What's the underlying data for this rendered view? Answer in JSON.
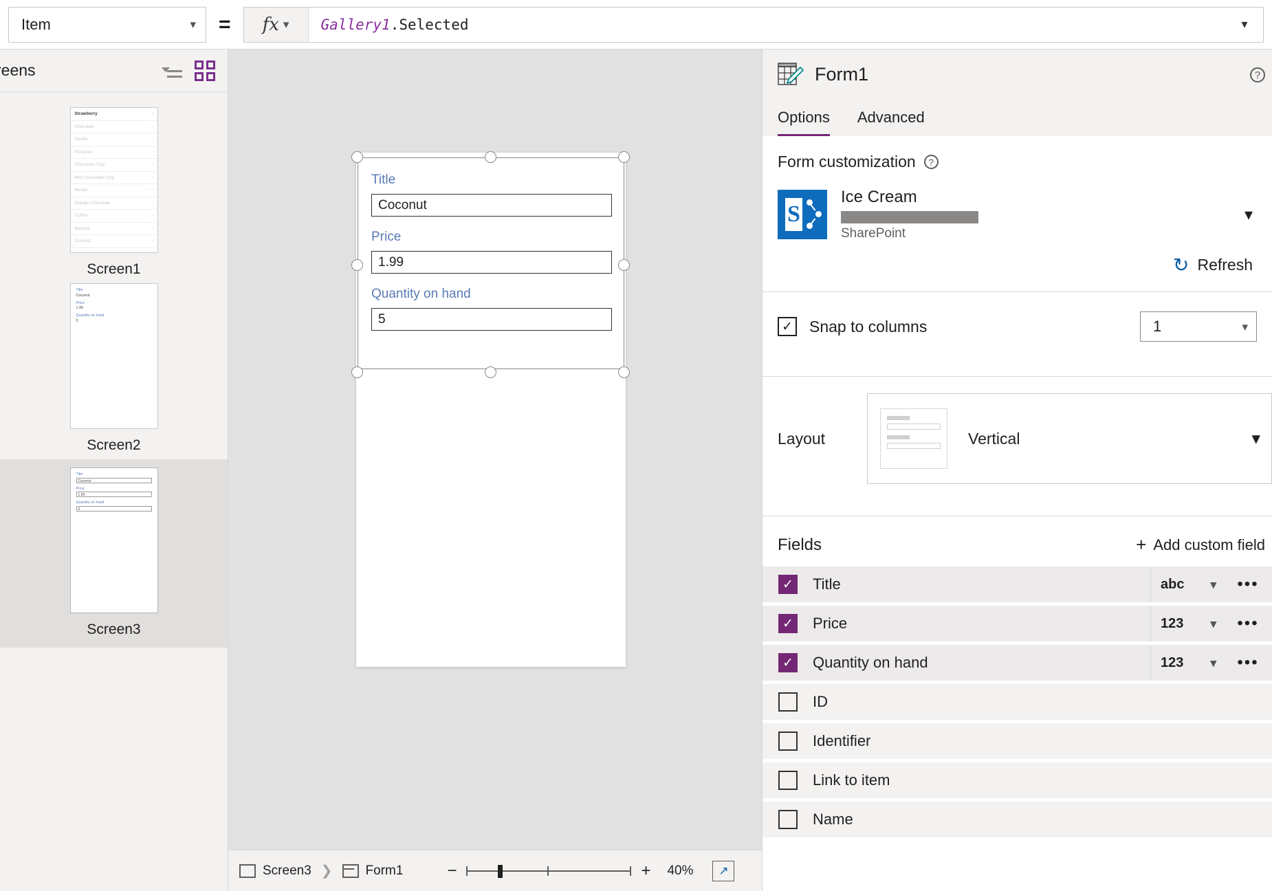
{
  "formula_bar": {
    "property": "Item",
    "equals": "=",
    "fx_label": "fx",
    "formula_identifier": "Gallery1",
    "formula_rest": ".Selected",
    "expand_icon": "chevron-down"
  },
  "left_pane": {
    "title": "reens",
    "tree_view_icon": "tree-view-icon",
    "grid_view_icon": "grid-view-icon",
    "screens": [
      {
        "label": "Screen1",
        "type": "gallery",
        "items": [
          "Strawberry",
          "Chocolate",
          "Vanilla",
          "Pistachio",
          "Chocolate Chip",
          "Mint Chocolate Chip",
          "Mango",
          "Orange Chocolate",
          "Coffee",
          "Banana",
          "Coconut"
        ]
      },
      {
        "label": "Screen2",
        "type": "form-text",
        "fields": [
          {
            "label": "Title",
            "value": "Coconut"
          },
          {
            "label": "Price",
            "value": "1.99"
          },
          {
            "label": "Quantity on hand",
            "value": "5"
          }
        ]
      },
      {
        "label": "Screen3",
        "type": "form-boxes",
        "selected": true,
        "fields": [
          {
            "label": "Title",
            "value": "Coconut"
          },
          {
            "label": "Price",
            "value": "1.99"
          },
          {
            "label": "Quantity on hand",
            "value": "5"
          }
        ]
      }
    ]
  },
  "canvas": {
    "form": {
      "fields": [
        {
          "label": "Title",
          "value": "Coconut"
        },
        {
          "label": "Price",
          "value": "1.99"
        },
        {
          "label": "Quantity on hand",
          "value": "5"
        }
      ]
    }
  },
  "status_bar": {
    "breadcrumb": [
      {
        "label": "Screen3",
        "icon": "screen-icon"
      },
      {
        "label": "Form1",
        "icon": "form-icon"
      }
    ],
    "zoom_out": "−",
    "zoom_in": "+",
    "zoom_level": "40%",
    "fit_icon": "fit-to-screen-icon"
  },
  "right_pane": {
    "title": "Form1",
    "icon": "form-edit-icon",
    "help_icon": "?",
    "tabs": [
      {
        "label": "Options",
        "active": true
      },
      {
        "label": "Advanced",
        "active": false
      }
    ],
    "form_customization": {
      "title": "Form customization",
      "help": "?",
      "data_source": {
        "name": "Ice Cream",
        "account_redacted": "",
        "kind": "SharePoint",
        "icon": "sharepoint-icon",
        "chevron": "chevron-down"
      },
      "refresh": {
        "label": "Refresh",
        "icon": "refresh-icon"
      }
    },
    "snap_to_columns": {
      "label": "Snap to columns",
      "checked": true,
      "check_glyph": "✓",
      "columns_value": "1",
      "chevron": "chevron-down"
    },
    "layout": {
      "label": "Layout",
      "value": "Vertical",
      "chevron": "chevron-down"
    },
    "fields_section": {
      "title": "Fields",
      "add_label": "Add custom field",
      "add_icon": "plus-icon",
      "rows": [
        {
          "name": "Title",
          "checked": true,
          "type": "abc",
          "more": "•••"
        },
        {
          "name": "Price",
          "checked": true,
          "type": "123",
          "more": "•••"
        },
        {
          "name": "Quantity on hand",
          "checked": true,
          "type": "123",
          "more": "•••"
        },
        {
          "name": "ID",
          "checked": false,
          "type": "",
          "more": ""
        },
        {
          "name": "Identifier",
          "checked": false,
          "type": "",
          "more": ""
        },
        {
          "name": "Link to item",
          "checked": false,
          "type": "",
          "more": ""
        },
        {
          "name": "Name",
          "checked": false,
          "type": "",
          "more": ""
        }
      ]
    }
  },
  "colors": {
    "accent_purple": "#742774",
    "sharepoint_blue": "#0f6cbd",
    "label_blue": "#5a7ab5",
    "link_blue": "#0b5fa5"
  }
}
